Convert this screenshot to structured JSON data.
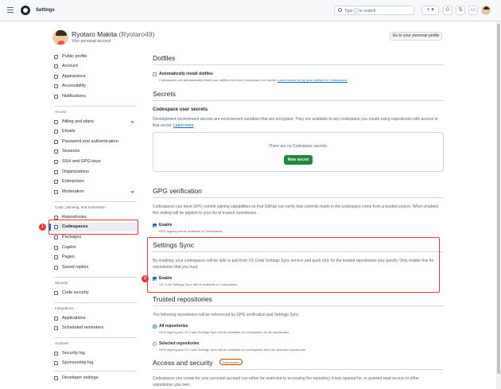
{
  "header": {
    "menu_icon": "hamburger-icon",
    "logo": "github-logo",
    "title": "Settings",
    "search_prefix": "Type",
    "search_key": "/",
    "search_suffix": "to search",
    "plus_label": "+ ▾",
    "icons": [
      "plus-icon",
      "issues-icon",
      "pull-requests-icon",
      "inbox-icon",
      "avatar"
    ]
  },
  "profile": {
    "name": "Ryotaro Makita",
    "login": "(Ryotaro49)",
    "subtitle": "Your personal account",
    "go_button": "Go to your personal profile"
  },
  "sidebar": {
    "items_top": [
      {
        "label": "Public profile",
        "icon": "person-icon"
      },
      {
        "label": "Account",
        "icon": "gear-icon"
      },
      {
        "label": "Appearance",
        "icon": "paintbrush-icon"
      },
      {
        "label": "Accessibility",
        "icon": "accessibility-icon"
      },
      {
        "label": "Notifications",
        "icon": "bell-icon"
      }
    ],
    "access_heading": "Access",
    "access_items": [
      {
        "label": "Billing and plans",
        "icon": "credit-card-icon"
      },
      {
        "label": "Emails",
        "icon": "mail-icon"
      },
      {
        "label": "Password and authentication",
        "icon": "shield-lock-icon"
      },
      {
        "label": "Sessions",
        "icon": "broadcast-icon"
      },
      {
        "label": "SSH and GPG keys",
        "icon": "key-icon"
      },
      {
        "label": "Organizations",
        "icon": "organization-icon"
      },
      {
        "label": "Enterprises",
        "icon": "globe-icon"
      },
      {
        "label": "Moderation",
        "icon": "report-icon"
      }
    ],
    "code_heading": "Code, planning, and automation",
    "code_items": [
      {
        "label": "Repositories",
        "icon": "repo-icon"
      },
      {
        "label": "Codespaces",
        "icon": "codespaces-icon"
      },
      {
        "label": "Packages",
        "icon": "package-icon"
      },
      {
        "label": "Copilot",
        "icon": "copilot-icon"
      },
      {
        "label": "Pages",
        "icon": "browser-icon"
      },
      {
        "label": "Saved replies",
        "icon": "reply-icon"
      }
    ],
    "security_heading": "Security",
    "security_items": [
      {
        "label": "Code security",
        "icon": "shield-icon"
      }
    ],
    "integrations_heading": "Integrations",
    "integrations_items": [
      {
        "label": "Applications",
        "icon": "apps-icon"
      },
      {
        "label": "Scheduled reminders",
        "icon": "clock-icon"
      }
    ],
    "archives_heading": "Archives",
    "archives_items": [
      {
        "label": "Security log",
        "icon": "log-icon"
      },
      {
        "label": "Sponsorship log",
        "icon": "log-icon"
      }
    ],
    "developer_settings": {
      "label": "Developer settings",
      "icon": "code-icon"
    }
  },
  "main": {
    "dotfiles": {
      "title": "Dotfiles",
      "checkbox_label": "Automatically install dotfiles",
      "checked": false,
      "description": "Codespaces can automatically install your dotfiles into every codespace you create.",
      "link": "Learn how to set up your dotfiles for Codespaces."
    },
    "secrets": {
      "title": "Secrets",
      "subtitle": "Codespace user secrets",
      "description": "Development environment secrets are environment variables that are encrypted. They are available to any codespace you create using repositories with access to that secret.",
      "link": "Learn more",
      "empty": "There are no Codespace secrets.",
      "button": "New secret"
    },
    "gpg": {
      "title": "GPG verification",
      "description": "Codespaces can have GPG commit signing capabilities so that GitHub can verify that commits made in the codespace come from a trusted source. When enabled, this setting will be applied to your list of trusted repositories.",
      "checkbox_label": "Enable",
      "checked": true,
      "note": "GPG signing will be available in Codespaces"
    },
    "sync": {
      "title": "Settings Sync",
      "description": "By enabling, your codespaces will be able to pull from VS Code Settings Sync service and push only for the trusted repositories you specify. Only enable this for repositories that you trust.",
      "checkbox_label": "Enable",
      "checked": true,
      "note": "VS Code Settings Sync will be available in Codespaces"
    },
    "trusted": {
      "title": "Trusted repositories",
      "description": "The following repositories will be referenced by GPG verification and Settings Sync.",
      "options": [
        {
          "label": "All repositories",
          "note": "GPG signing and VS Code Settings Sync will be available for codespaces for all repositories",
          "selected": true
        },
        {
          "label": "Selected repositories",
          "note": "GPG signing and VS Code Settings Sync will be available for codespaces from the selected repositories",
          "selected": false
        }
      ]
    },
    "access": {
      "title": "Access and security",
      "badge": "Deprecated",
      "description": "Codespaces you create for your personal account can either be restricted to accessing the repository it was opened for, or granted read access to other repositories you own."
    }
  },
  "annotations": {
    "marker_1": "1",
    "marker_2": "2",
    "color": "#e5383b"
  },
  "colors": {
    "accent": "#0969da",
    "primary_button": "#1f883d",
    "deprecated": "#bc4c00"
  }
}
